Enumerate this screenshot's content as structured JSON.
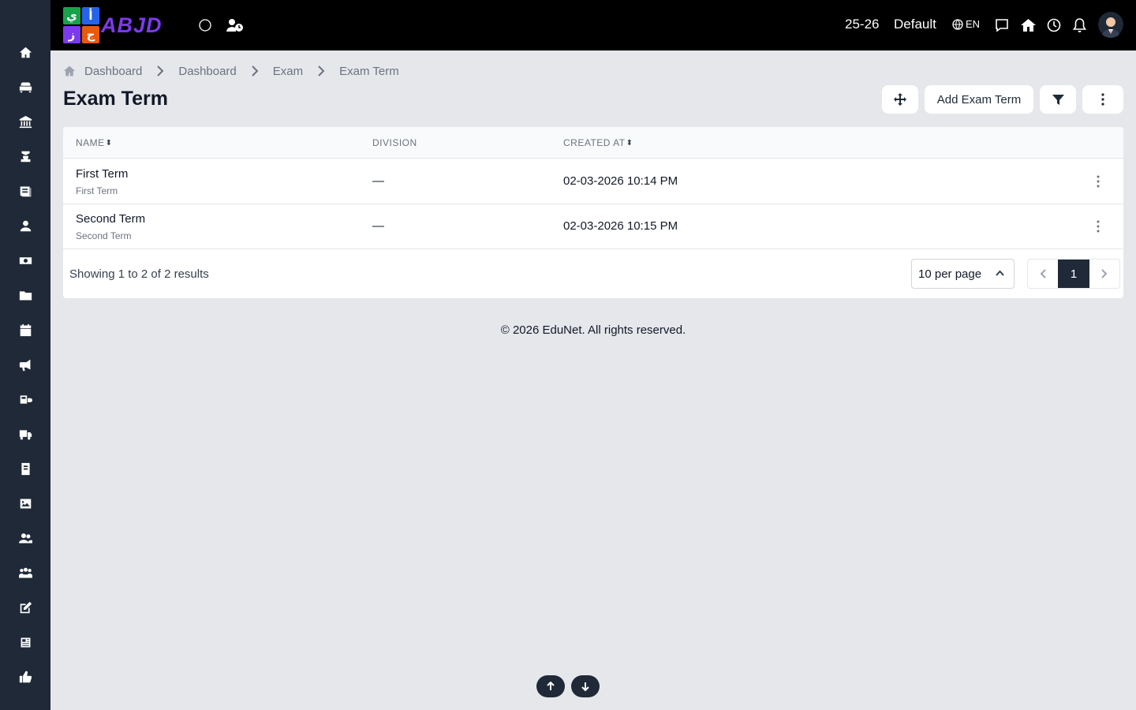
{
  "app": {
    "logo_cells": [
      "ي",
      "أ",
      "ز",
      "ج"
    ],
    "logo_text": "ABJD",
    "colors": {
      "sidebar": "#1f2937",
      "topbar": "#000000",
      "background": "#e5e7eb",
      "accent": "#1f2937"
    }
  },
  "sidebar": {
    "items": [
      {
        "icon": "home-icon"
      },
      {
        "icon": "sofa-icon"
      },
      {
        "icon": "bank-icon"
      },
      {
        "icon": "graduation-icon"
      },
      {
        "icon": "book-icon"
      },
      {
        "icon": "teacher-icon"
      },
      {
        "icon": "money-icon"
      },
      {
        "icon": "folder-icon"
      },
      {
        "icon": "calendar-icon"
      },
      {
        "icon": "megaphone-icon"
      },
      {
        "icon": "school-bus-icon"
      },
      {
        "icon": "truck-icon"
      },
      {
        "icon": "notebook-icon"
      },
      {
        "icon": "image-icon"
      },
      {
        "icon": "users-icon"
      },
      {
        "icon": "group-icon"
      },
      {
        "icon": "edit-icon"
      },
      {
        "icon": "news-icon"
      },
      {
        "icon": "thumbs-up-icon"
      }
    ]
  },
  "topbar": {
    "session": "25-26",
    "profile": "Default",
    "language": "EN"
  },
  "breadcrumb": {
    "items": [
      "Dashboard",
      "Dashboard",
      "Exam",
      "Exam Term"
    ]
  },
  "page": {
    "title": "Exam Term",
    "add_button": "Add Exam Term"
  },
  "table": {
    "columns": {
      "name": "NAME",
      "division": "DIVISION",
      "created_at": "CREATED AT"
    },
    "rows": [
      {
        "name": "First Term",
        "subtitle": "First Term",
        "division": "—",
        "created_at": "02-03-2026 10:14 PM"
      },
      {
        "name": "Second Term",
        "subtitle": "Second Term",
        "division": "—",
        "created_at": "02-03-2026 10:15 PM"
      }
    ],
    "results_text": "Showing 1 to 2 of 2 results",
    "per_page": "10 per page",
    "current_page": "1"
  },
  "footer": {
    "text": "© 2026 EduNet. All rights reserved."
  }
}
